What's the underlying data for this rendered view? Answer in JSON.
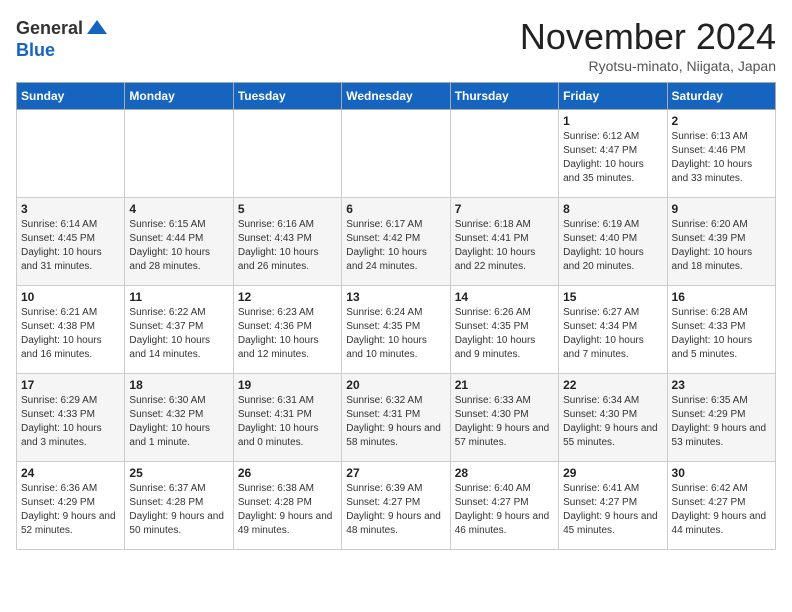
{
  "logo": {
    "general": "General",
    "blue": "Blue"
  },
  "title": "November 2024",
  "location": "Ryotsu-minato, Niigata, Japan",
  "days_of_week": [
    "Sunday",
    "Monday",
    "Tuesday",
    "Wednesday",
    "Thursday",
    "Friday",
    "Saturday"
  ],
  "weeks": [
    [
      {
        "day": "",
        "info": ""
      },
      {
        "day": "",
        "info": ""
      },
      {
        "day": "",
        "info": ""
      },
      {
        "day": "",
        "info": ""
      },
      {
        "day": "",
        "info": ""
      },
      {
        "day": "1",
        "info": "Sunrise: 6:12 AM\nSunset: 4:47 PM\nDaylight: 10 hours and 35 minutes."
      },
      {
        "day": "2",
        "info": "Sunrise: 6:13 AM\nSunset: 4:46 PM\nDaylight: 10 hours and 33 minutes."
      }
    ],
    [
      {
        "day": "3",
        "info": "Sunrise: 6:14 AM\nSunset: 4:45 PM\nDaylight: 10 hours and 31 minutes."
      },
      {
        "day": "4",
        "info": "Sunrise: 6:15 AM\nSunset: 4:44 PM\nDaylight: 10 hours and 28 minutes."
      },
      {
        "day": "5",
        "info": "Sunrise: 6:16 AM\nSunset: 4:43 PM\nDaylight: 10 hours and 26 minutes."
      },
      {
        "day": "6",
        "info": "Sunrise: 6:17 AM\nSunset: 4:42 PM\nDaylight: 10 hours and 24 minutes."
      },
      {
        "day": "7",
        "info": "Sunrise: 6:18 AM\nSunset: 4:41 PM\nDaylight: 10 hours and 22 minutes."
      },
      {
        "day": "8",
        "info": "Sunrise: 6:19 AM\nSunset: 4:40 PM\nDaylight: 10 hours and 20 minutes."
      },
      {
        "day": "9",
        "info": "Sunrise: 6:20 AM\nSunset: 4:39 PM\nDaylight: 10 hours and 18 minutes."
      }
    ],
    [
      {
        "day": "10",
        "info": "Sunrise: 6:21 AM\nSunset: 4:38 PM\nDaylight: 10 hours and 16 minutes."
      },
      {
        "day": "11",
        "info": "Sunrise: 6:22 AM\nSunset: 4:37 PM\nDaylight: 10 hours and 14 minutes."
      },
      {
        "day": "12",
        "info": "Sunrise: 6:23 AM\nSunset: 4:36 PM\nDaylight: 10 hours and 12 minutes."
      },
      {
        "day": "13",
        "info": "Sunrise: 6:24 AM\nSunset: 4:35 PM\nDaylight: 10 hours and 10 minutes."
      },
      {
        "day": "14",
        "info": "Sunrise: 6:26 AM\nSunset: 4:35 PM\nDaylight: 10 hours and 9 minutes."
      },
      {
        "day": "15",
        "info": "Sunrise: 6:27 AM\nSunset: 4:34 PM\nDaylight: 10 hours and 7 minutes."
      },
      {
        "day": "16",
        "info": "Sunrise: 6:28 AM\nSunset: 4:33 PM\nDaylight: 10 hours and 5 minutes."
      }
    ],
    [
      {
        "day": "17",
        "info": "Sunrise: 6:29 AM\nSunset: 4:33 PM\nDaylight: 10 hours and 3 minutes."
      },
      {
        "day": "18",
        "info": "Sunrise: 6:30 AM\nSunset: 4:32 PM\nDaylight: 10 hours and 1 minute."
      },
      {
        "day": "19",
        "info": "Sunrise: 6:31 AM\nSunset: 4:31 PM\nDaylight: 10 hours and 0 minutes."
      },
      {
        "day": "20",
        "info": "Sunrise: 6:32 AM\nSunset: 4:31 PM\nDaylight: 9 hours and 58 minutes."
      },
      {
        "day": "21",
        "info": "Sunrise: 6:33 AM\nSunset: 4:30 PM\nDaylight: 9 hours and 57 minutes."
      },
      {
        "day": "22",
        "info": "Sunrise: 6:34 AM\nSunset: 4:30 PM\nDaylight: 9 hours and 55 minutes."
      },
      {
        "day": "23",
        "info": "Sunrise: 6:35 AM\nSunset: 4:29 PM\nDaylight: 9 hours and 53 minutes."
      }
    ],
    [
      {
        "day": "24",
        "info": "Sunrise: 6:36 AM\nSunset: 4:29 PM\nDaylight: 9 hours and 52 minutes."
      },
      {
        "day": "25",
        "info": "Sunrise: 6:37 AM\nSunset: 4:28 PM\nDaylight: 9 hours and 50 minutes."
      },
      {
        "day": "26",
        "info": "Sunrise: 6:38 AM\nSunset: 4:28 PM\nDaylight: 9 hours and 49 minutes."
      },
      {
        "day": "27",
        "info": "Sunrise: 6:39 AM\nSunset: 4:27 PM\nDaylight: 9 hours and 48 minutes."
      },
      {
        "day": "28",
        "info": "Sunrise: 6:40 AM\nSunset: 4:27 PM\nDaylight: 9 hours and 46 minutes."
      },
      {
        "day": "29",
        "info": "Sunrise: 6:41 AM\nSunset: 4:27 PM\nDaylight: 9 hours and 45 minutes."
      },
      {
        "day": "30",
        "info": "Sunrise: 6:42 AM\nSunset: 4:27 PM\nDaylight: 9 hours and 44 minutes."
      }
    ]
  ]
}
